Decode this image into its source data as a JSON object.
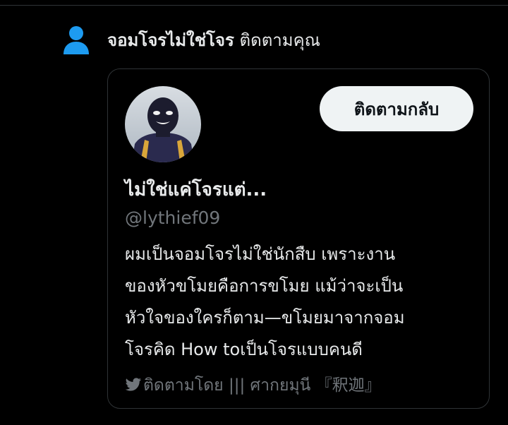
{
  "notification": {
    "name": "จอมโจรไม่ใช่โจร",
    "action": "ติดตามคุณ",
    "icon": "person-icon",
    "icon_color": "#1d9bf0"
  },
  "card": {
    "follow_back_label": "ติดตามกลับ",
    "display_name": "ไม่ใช่แค่โจรแต่...",
    "handle": "@lythief09",
    "bio_lines": [
      "ผมเป็นจอมโจรไม่ใช่นักสืบ เพราะงาน",
      "ของหัวขโมยคือการขโมย แม้ว่าจะเป็น",
      "หัวใจของใครก็ตาม—ขโมยมาจากจอม",
      "โจรคิด How toเป็นโจรแบบคนดี"
    ],
    "footer_text": "ติดตามโดย ||| ศากยมุนี 『釈迦』",
    "footer_icon": "bird-icon"
  },
  "colors": {
    "background": "#000000",
    "text_primary": "#e7e9ea",
    "text_secondary": "#71767b",
    "accent": "#1d9bf0",
    "button_bg": "#eff3f4"
  }
}
